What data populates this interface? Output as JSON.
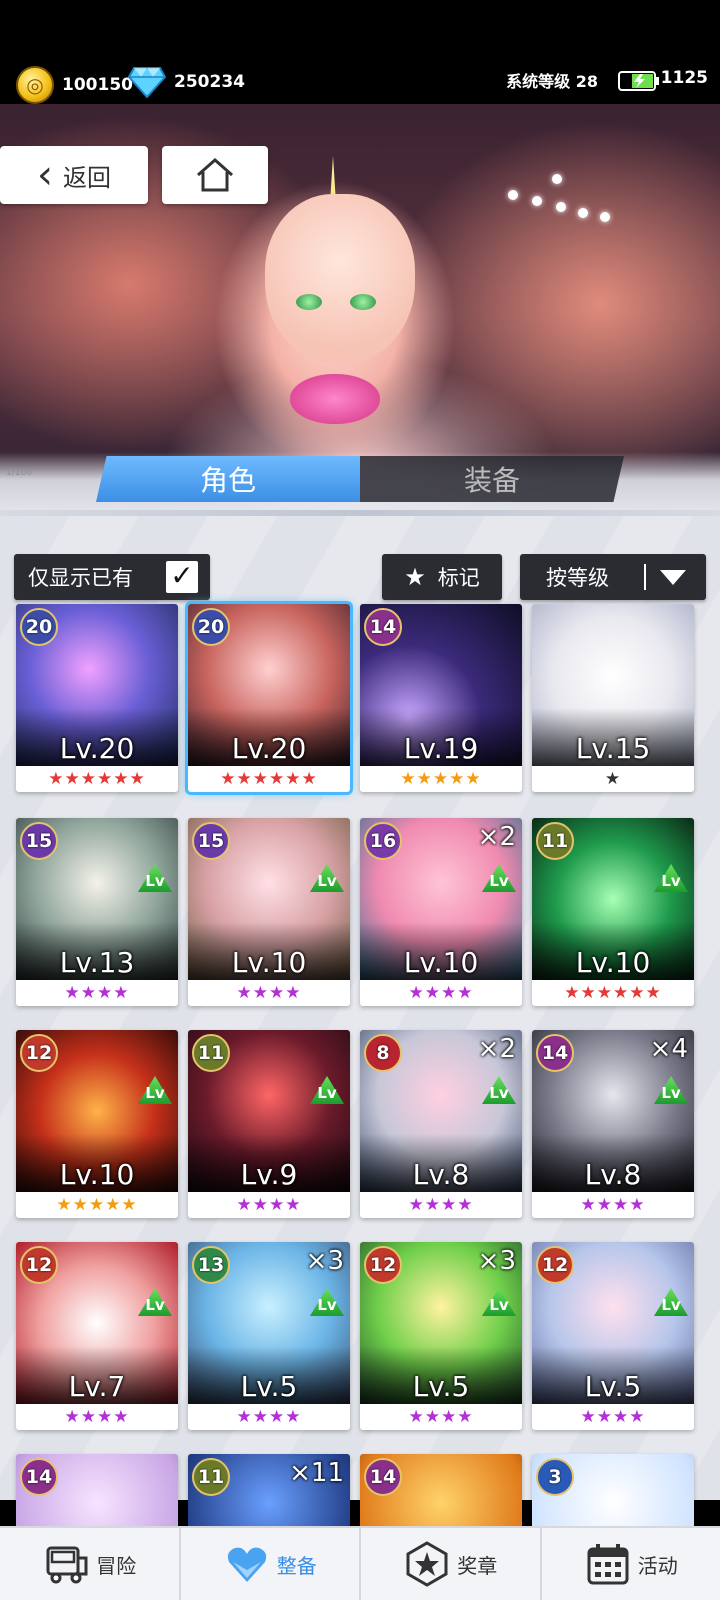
{
  "header": {
    "coins": "100150",
    "gems": "250234",
    "system_level": "系统等级 28",
    "energy": "1125"
  },
  "nav": {
    "back_label": "返回"
  },
  "tabs": [
    {
      "label": "角色",
      "active": true
    },
    {
      "label": "装备",
      "active": false
    }
  ],
  "deco": {
    "left": "1/100",
    "right": ""
  },
  "filters": {
    "owned_only": "仅显示已有",
    "owned_checked": true,
    "mark": "标记",
    "sort": "按等级"
  },
  "cards": [
    {
      "badge": "20",
      "lv": "Lv.20",
      "stars": "★★★★★★",
      "star_color": "#e53935",
      "mult": "",
      "lvup": false
    },
    {
      "badge": "20",
      "lv": "Lv.20",
      "stars": "★★★★★★",
      "star_color": "#e53935",
      "mult": "",
      "lvup": false,
      "selected": true
    },
    {
      "badge": "14",
      "lv": "Lv.19",
      "stars": "★★★★★",
      "star_color": "#f39c12",
      "mult": "",
      "lvup": false
    },
    {
      "badge": "",
      "lv": "Lv.15",
      "stars": "★",
      "star_color": "#333333",
      "mult": "",
      "lvup": false
    },
    {
      "badge": "15",
      "lv": "Lv.13",
      "stars": "★★★★",
      "star_color": "#b52fd8",
      "mult": "",
      "lvup": true
    },
    {
      "badge": "15",
      "lv": "Lv.10",
      "stars": "★★★★",
      "star_color": "#b52fd8",
      "mult": "",
      "lvup": true
    },
    {
      "badge": "16",
      "lv": "Lv.10",
      "stars": "★★★★",
      "star_color": "#b52fd8",
      "mult": "×2",
      "lvup": true
    },
    {
      "badge": "11",
      "lv": "Lv.10",
      "stars": "★★★★★★",
      "star_color": "#e53935",
      "mult": "",
      "lvup": true
    },
    {
      "badge": "12",
      "lv": "Lv.10",
      "stars": "★★★★★",
      "star_color": "#f39c12",
      "mult": "",
      "lvup": true
    },
    {
      "badge": "11",
      "lv": "Lv.9",
      "stars": "★★★★",
      "star_color": "#b52fd8",
      "mult": "",
      "lvup": true
    },
    {
      "badge": "8",
      "lv": "Lv.8",
      "stars": "★★★★",
      "star_color": "#b52fd8",
      "mult": "×2",
      "lvup": true
    },
    {
      "badge": "14",
      "lv": "Lv.8",
      "stars": "★★★★",
      "star_color": "#b52fd8",
      "mult": "×4",
      "lvup": true
    },
    {
      "badge": "12",
      "lv": "Lv.7",
      "stars": "★★★★",
      "star_color": "#b52fd8",
      "mult": "",
      "lvup": true
    },
    {
      "badge": "13",
      "lv": "Lv.5",
      "stars": "★★★★",
      "star_color": "#b52fd8",
      "mult": "×3",
      "lvup": true
    },
    {
      "badge": "12",
      "lv": "Lv.5",
      "stars": "★★★★",
      "star_color": "#b52fd8",
      "mult": "×3",
      "lvup": true
    },
    {
      "badge": "12",
      "lv": "Lv.5",
      "stars": "★★★★",
      "star_color": "#b52fd8",
      "mult": "",
      "lvup": true
    },
    {
      "badge": "14",
      "lv": "",
      "stars": "",
      "star_color": "#b52fd8",
      "mult": "",
      "lvup": false
    },
    {
      "badge": "11",
      "lv": "",
      "stars": "",
      "star_color": "#b52fd8",
      "mult": "×11",
      "lvup": false
    },
    {
      "badge": "14",
      "lv": "",
      "stars": "",
      "star_color": "#b52fd8",
      "mult": "",
      "lvup": false
    },
    {
      "badge": "3",
      "lv": "",
      "stars": "",
      "star_color": "#b52fd8",
      "mult": "",
      "lvup": false
    }
  ],
  "bottom_nav": [
    {
      "label": "冒险",
      "icon": "truck-icon",
      "active": false
    },
    {
      "label": "整备",
      "icon": "heart-gem-icon",
      "active": true
    },
    {
      "label": "奖章",
      "icon": "medal-star-icon",
      "active": false
    },
    {
      "label": "活动",
      "icon": "calendar-icon",
      "active": false
    }
  ]
}
